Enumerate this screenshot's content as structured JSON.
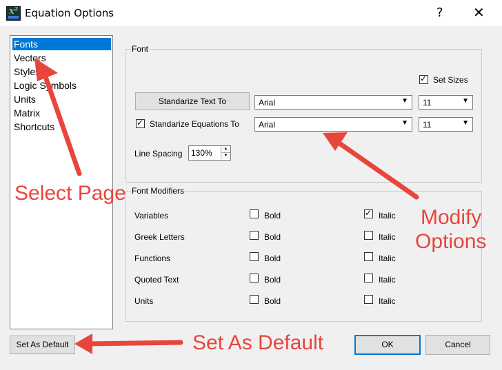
{
  "window": {
    "title": "Equation Options",
    "help_glyph": "?",
    "close_glyph": "✕"
  },
  "sidebar": {
    "items": [
      {
        "label": "Fonts",
        "selected": true
      },
      {
        "label": "Vectors",
        "selected": false
      },
      {
        "label": "Styles",
        "selected": false
      },
      {
        "label": "Logic Symbols",
        "selected": false
      },
      {
        "label": "Units",
        "selected": false
      },
      {
        "label": "Matrix",
        "selected": false
      },
      {
        "label": "Shortcuts",
        "selected": false
      }
    ]
  },
  "font_group": {
    "label": "Font",
    "set_sizes_label": "Set Sizes",
    "set_sizes_checked": true,
    "standardize_text_button": "Standarize Text To",
    "text_font": "Arial",
    "text_size": "11",
    "standardize_equations_label": "Standarize Equations To",
    "standardize_equations_checked": true,
    "equation_font": "Arial",
    "equation_size": "11",
    "line_spacing_label": "Line Spacing",
    "line_spacing_value": "130%"
  },
  "modifiers_group": {
    "label": "Font Modifiers",
    "bold_label": "Bold",
    "italic_label": "Italic",
    "rows": [
      {
        "name": "Variables",
        "bold": false,
        "italic": true
      },
      {
        "name": "Greek Letters",
        "bold": false,
        "italic": false
      },
      {
        "name": "Functions",
        "bold": false,
        "italic": false
      },
      {
        "name": "Quoted Text",
        "bold": false,
        "italic": false
      },
      {
        "name": "Units",
        "bold": false,
        "italic": false
      }
    ]
  },
  "footer": {
    "set_default_button": "Set As Default",
    "ok_button": "OK",
    "cancel_button": "Cancel"
  },
  "annotations": {
    "select_page": "Select Page",
    "modify_line1": "Modify",
    "modify_line2": "Options",
    "set_as_default": "Set As Default",
    "color": "#e8453c"
  },
  "colors": {
    "selection": "#0078d7",
    "dialog_bg": "#f0f0f0"
  }
}
